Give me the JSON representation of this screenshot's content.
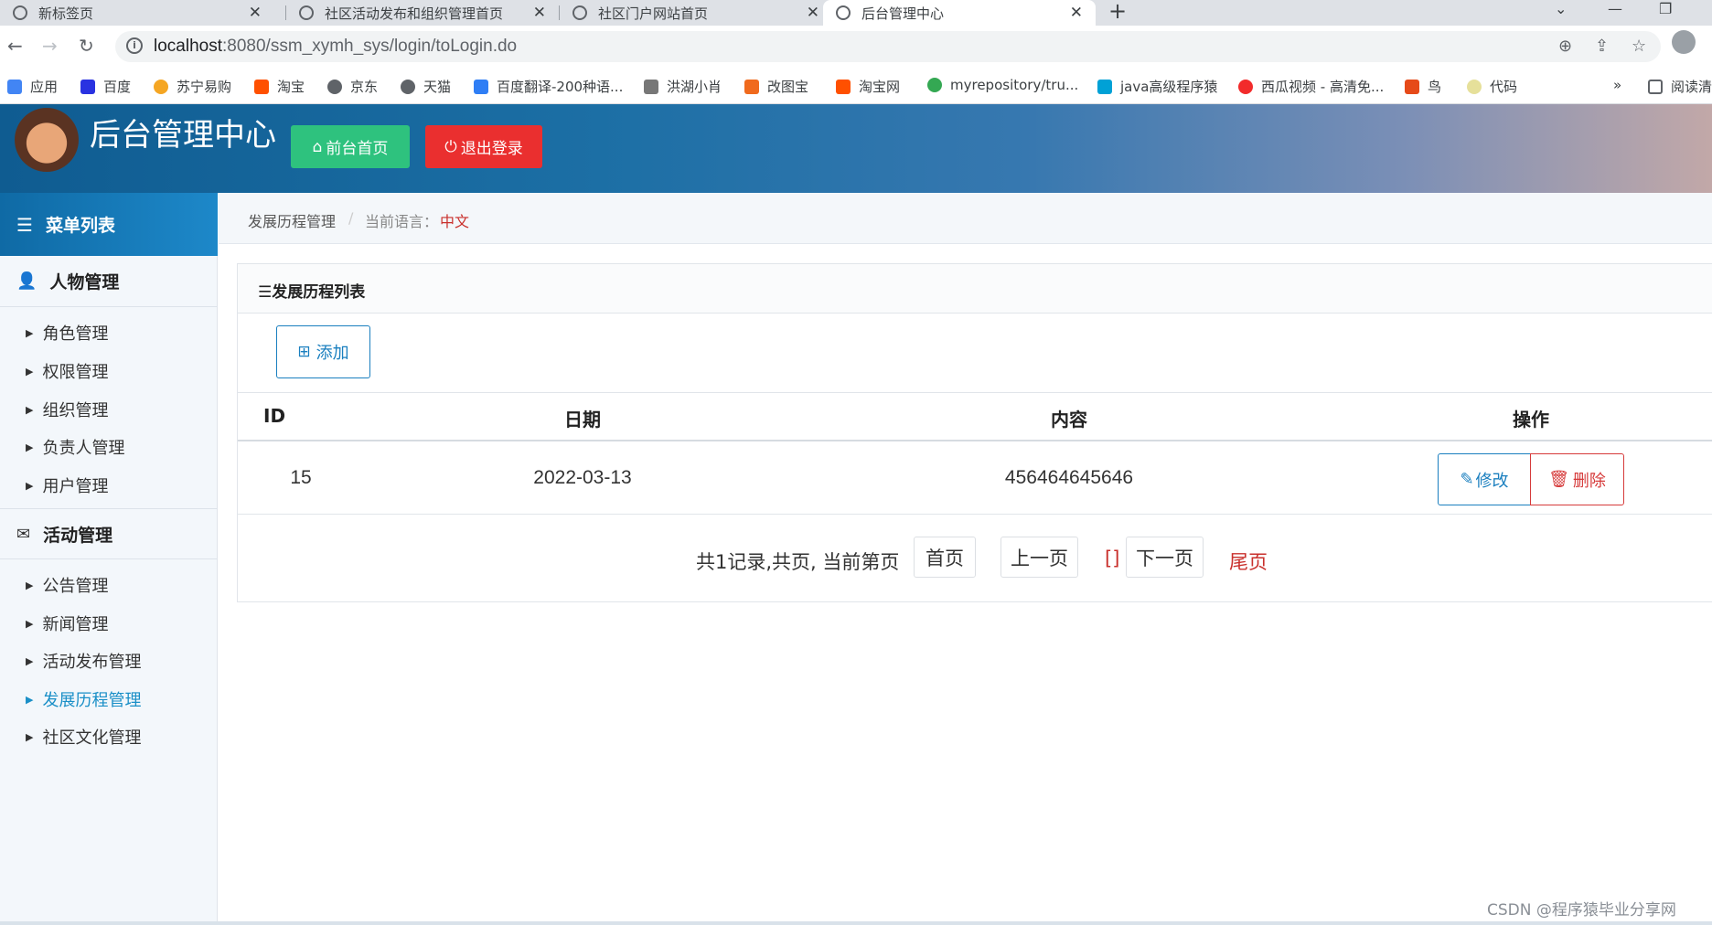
{
  "browser": {
    "tabs": [
      {
        "label": "新标签页",
        "active": false
      },
      {
        "label": "社区活动发布和组织管理首页",
        "active": false
      },
      {
        "label": "社区门户网站首页",
        "active": false
      },
      {
        "label": "后台管理中心",
        "active": true
      }
    ],
    "url_host": "localhost",
    "url_rest": ":8080/ssm_xymh_sys/login/toLogin.do",
    "bookmarks": [
      {
        "label": "应用",
        "color": "#4285f4"
      },
      {
        "label": "百度",
        "color": "#2932e1"
      },
      {
        "label": "苏宁易购",
        "color": "#f5a623"
      },
      {
        "label": "淘宝",
        "color": "#ff5000"
      },
      {
        "label": "京东",
        "color": "#5f6368"
      },
      {
        "label": "天猫",
        "color": "#5f6368"
      },
      {
        "label": "百度翻译-200种语...",
        "color": "#2f7ef5"
      },
      {
        "label": "洪湖小肖",
        "color": "#777777"
      },
      {
        "label": "改图宝",
        "color": "#f06a1d"
      },
      {
        "label": "淘宝网",
        "color": "#ff5000"
      },
      {
        "label": "myrepository/tru...",
        "color": "#34a853"
      },
      {
        "label": "java高级程序猿",
        "color": "#00a1d6"
      },
      {
        "label": "西瓜视频 - 高清免...",
        "color": "#f22b2b"
      },
      {
        "label": "鸟",
        "color": "#e64a19"
      },
      {
        "label": "代码",
        "color": "#e6e09a"
      }
    ],
    "more": "»",
    "reading_list": "阅读清"
  },
  "header": {
    "title": "后台管理中心",
    "home_button": "前台首页",
    "logout_button": "退出登录",
    "home_icon": "home-icon",
    "logout_icon": "power-icon"
  },
  "sidebar": {
    "title": "菜单列表",
    "groups": [
      {
        "label": "人物管理",
        "icon": "user-icon",
        "items": [
          "角色管理",
          "权限管理",
          "组织管理",
          "负责人管理",
          "用户管理"
        ]
      },
      {
        "label": "活动管理",
        "icon": "envelope-icon",
        "items": [
          "公告管理",
          "新闻管理",
          "活动发布管理",
          "发展历程管理",
          "社区文化管理"
        ]
      }
    ],
    "active_item": "发展历程管理"
  },
  "breadcrumb": {
    "current": "发展历程管理",
    "sep": "/",
    "lang_label": "当前语言：",
    "lang_value": "中文"
  },
  "panel": {
    "title": "☰发展历程列表",
    "add_button": "添加",
    "columns": [
      "ID",
      "日期",
      "内容",
      "操作"
    ],
    "rows": [
      {
        "id": "15",
        "date": "2022-03-13",
        "content": "456464645646",
        "edit": "修改",
        "delete": "删除"
      }
    ]
  },
  "pager": {
    "summary": "共1记录,共页, 当前第页",
    "first": "首页",
    "prev": "上一页",
    "brackets": "[]",
    "next": "下一页",
    "last": "尾页"
  },
  "watermark": "CSDN @程序猿毕业分享网"
}
